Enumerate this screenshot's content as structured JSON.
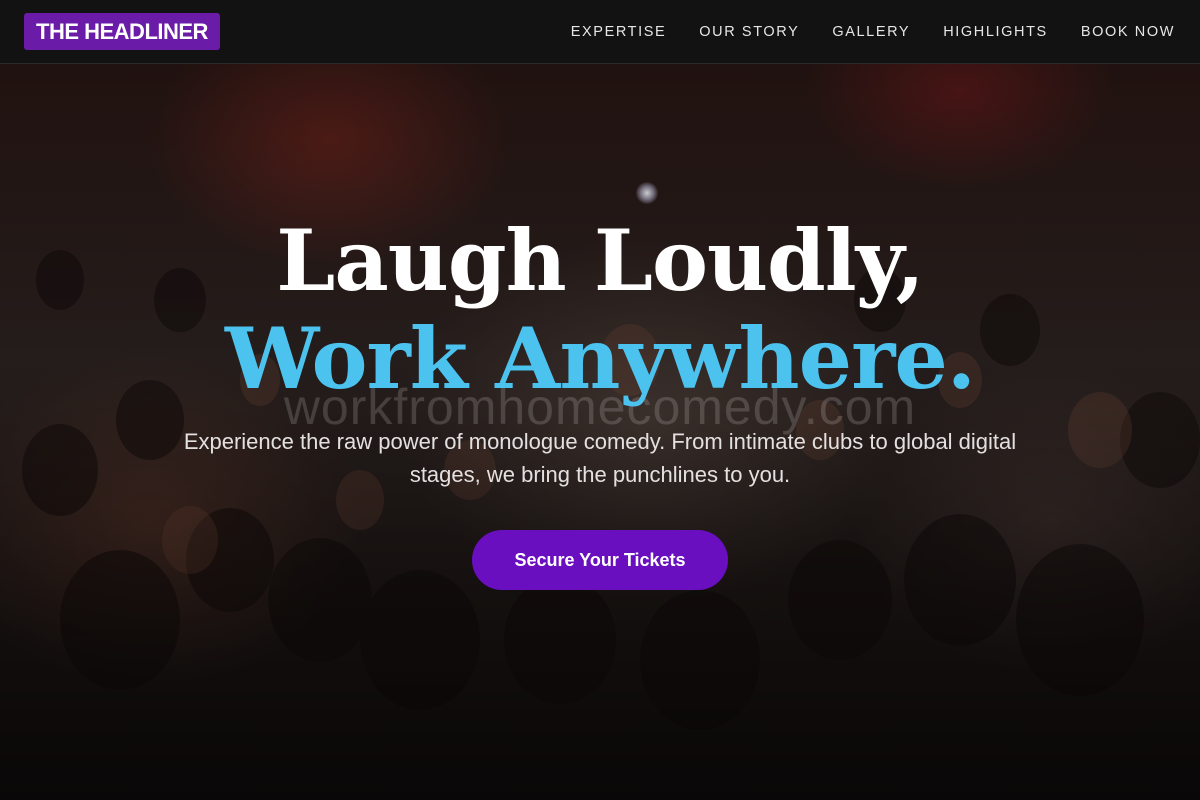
{
  "brand": {
    "name": "THE HEADLINER",
    "color": "#6a1ba8"
  },
  "nav": {
    "items": [
      {
        "label": "EXPERTISE"
      },
      {
        "label": "OUR STORY"
      },
      {
        "label": "GALLERY"
      },
      {
        "label": "HIGHLIGHTS"
      },
      {
        "label": "BOOK NOW"
      }
    ]
  },
  "hero": {
    "background_image": "concert-crowd-photo",
    "headline_line1": "Laugh Loudly,",
    "headline_line2": "Work Anywhere.",
    "headline_accent_color": "#4cc2ef",
    "watermark": "workfromhomecomedy.com",
    "subtext": "Experience the raw power of monologue comedy. From intimate clubs to global digital stages, we bring the punchlines to you.",
    "cta_label": "Secure Your Tickets",
    "cta_color": "#6a0fc0"
  }
}
